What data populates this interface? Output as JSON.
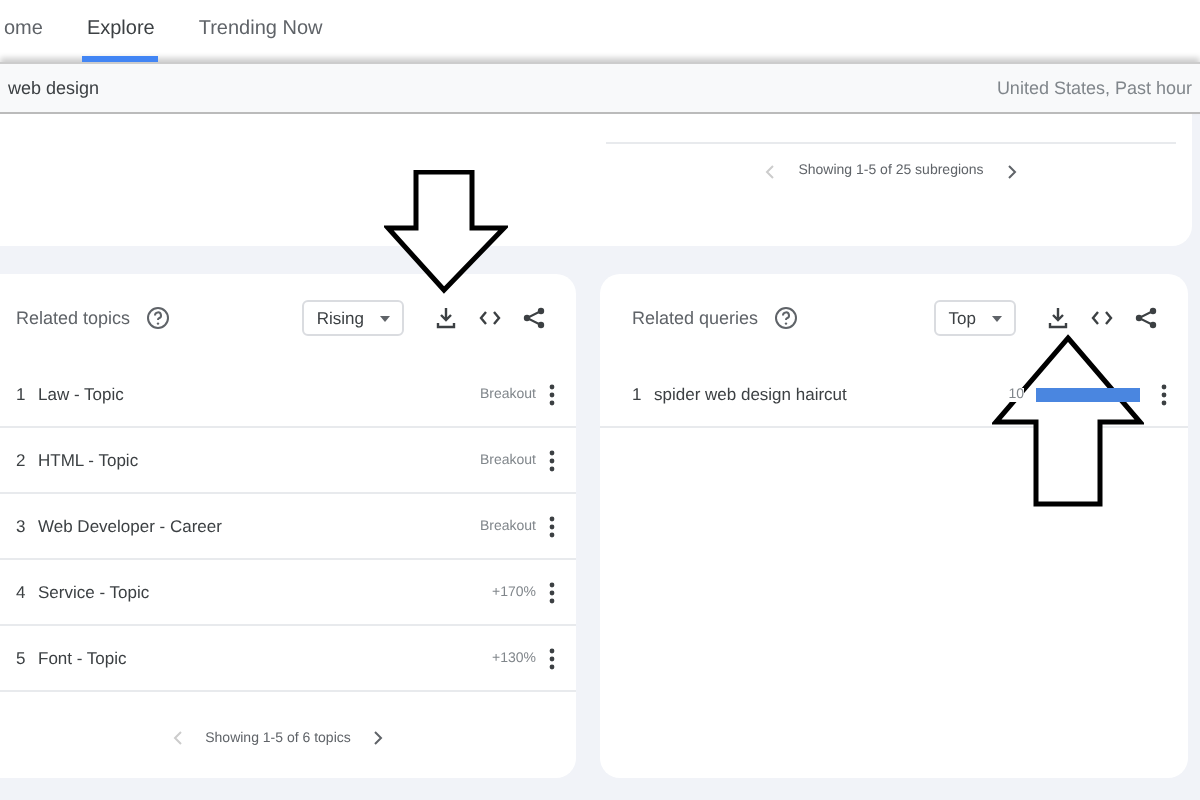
{
  "nav": {
    "tabs": [
      {
        "label": "ome",
        "selected": false
      },
      {
        "label": "Explore",
        "selected": true
      },
      {
        "label": "Trending Now",
        "selected": false
      }
    ]
  },
  "search": {
    "value": "web design",
    "filters": "United States, Past hour"
  },
  "subregions": {
    "pager": "Showing 1-5 of 25 subregions"
  },
  "panels": [
    {
      "title": "Related topics",
      "dropdown": "Rising",
      "rows": [
        {
          "rank": "1",
          "label": "Law - Topic",
          "value": "Breakout"
        },
        {
          "rank": "2",
          "label": "HTML - Topic",
          "value": "Breakout"
        },
        {
          "rank": "3",
          "label": "Web Developer - Career",
          "value": "Breakout"
        },
        {
          "rank": "4",
          "label": "Service - Topic",
          "value": "+170%"
        },
        {
          "rank": "5",
          "label": "Font - Topic",
          "value": "+130%"
        }
      ],
      "pager": "Showing 1-5 of 6 topics"
    },
    {
      "title": "Related queries",
      "dropdown": "Top",
      "rows": [
        {
          "rank": "1",
          "label": "spider web design haircut",
          "value": "10",
          "level": 1
        }
      ]
    }
  ]
}
